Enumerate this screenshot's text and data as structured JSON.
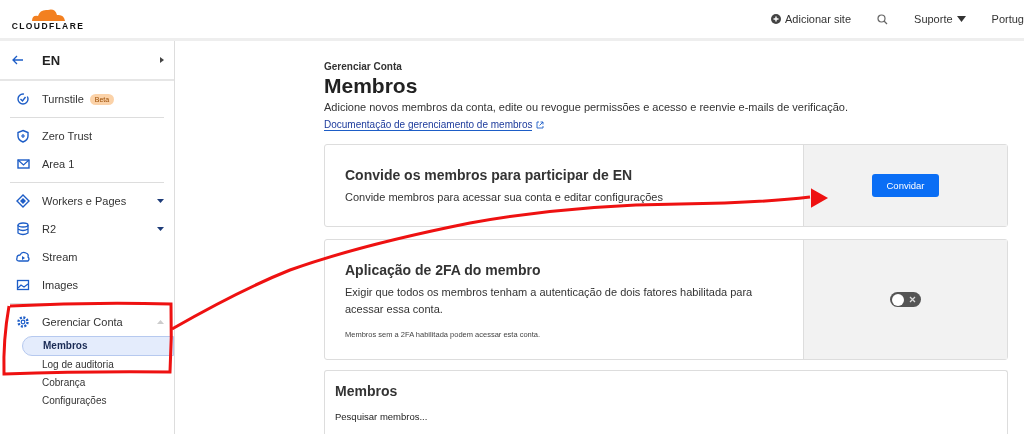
{
  "header": {
    "logo": "CLOUDFLARE",
    "add_site": "Adicionar site",
    "support": "Suporte",
    "language": "Portug"
  },
  "sidebar": {
    "account": "EN",
    "sections": [
      [
        {
          "label": "Turnstile",
          "badge": "Beta"
        }
      ],
      [
        {
          "label": "Zero Trust"
        },
        {
          "label": "Area 1"
        }
      ],
      [
        {
          "label": "Workers e Pages",
          "expanded": false
        },
        {
          "label": "R2",
          "expanded": false
        },
        {
          "label": "Stream"
        },
        {
          "label": "Images"
        }
      ],
      [
        {
          "label": "Gerenciar Conta",
          "expanded": true,
          "children": [
            {
              "label": "Membros",
              "selected": true
            },
            {
              "label": "Log de auditoria",
              "selected": false
            },
            {
              "label": "Cobrança",
              "selected": false
            },
            {
              "label": "Configurações",
              "selected": false
            }
          ]
        }
      ]
    ]
  },
  "page": {
    "breadcrumb": "Gerenciar Conta",
    "title": "Membros",
    "description": "Adicione novos membros da conta, edite ou revogue permissões e acesso e reenvie e-mails de verificação.",
    "doc_link": "Documentação de gerenciamento de membros"
  },
  "cards": [
    {
      "kind": "button",
      "title": "Convide os membros para participar de EN",
      "text": "Convide membros para acessar sua conta e editar configurações",
      "button": "Convidar"
    },
    {
      "kind": "toggle",
      "title": "Aplicação de 2FA do membro",
      "text": "Exigir que todos os membros tenham a autenticação de dois fatores habilitada para acessar essa conta.",
      "note": "Membros sem a 2FA habilitada podem acessar esta conta.",
      "on": false
    }
  ],
  "members": {
    "title": "Membros",
    "search": {
      "placeholder": "Pesquisar membros..."
    }
  }
}
